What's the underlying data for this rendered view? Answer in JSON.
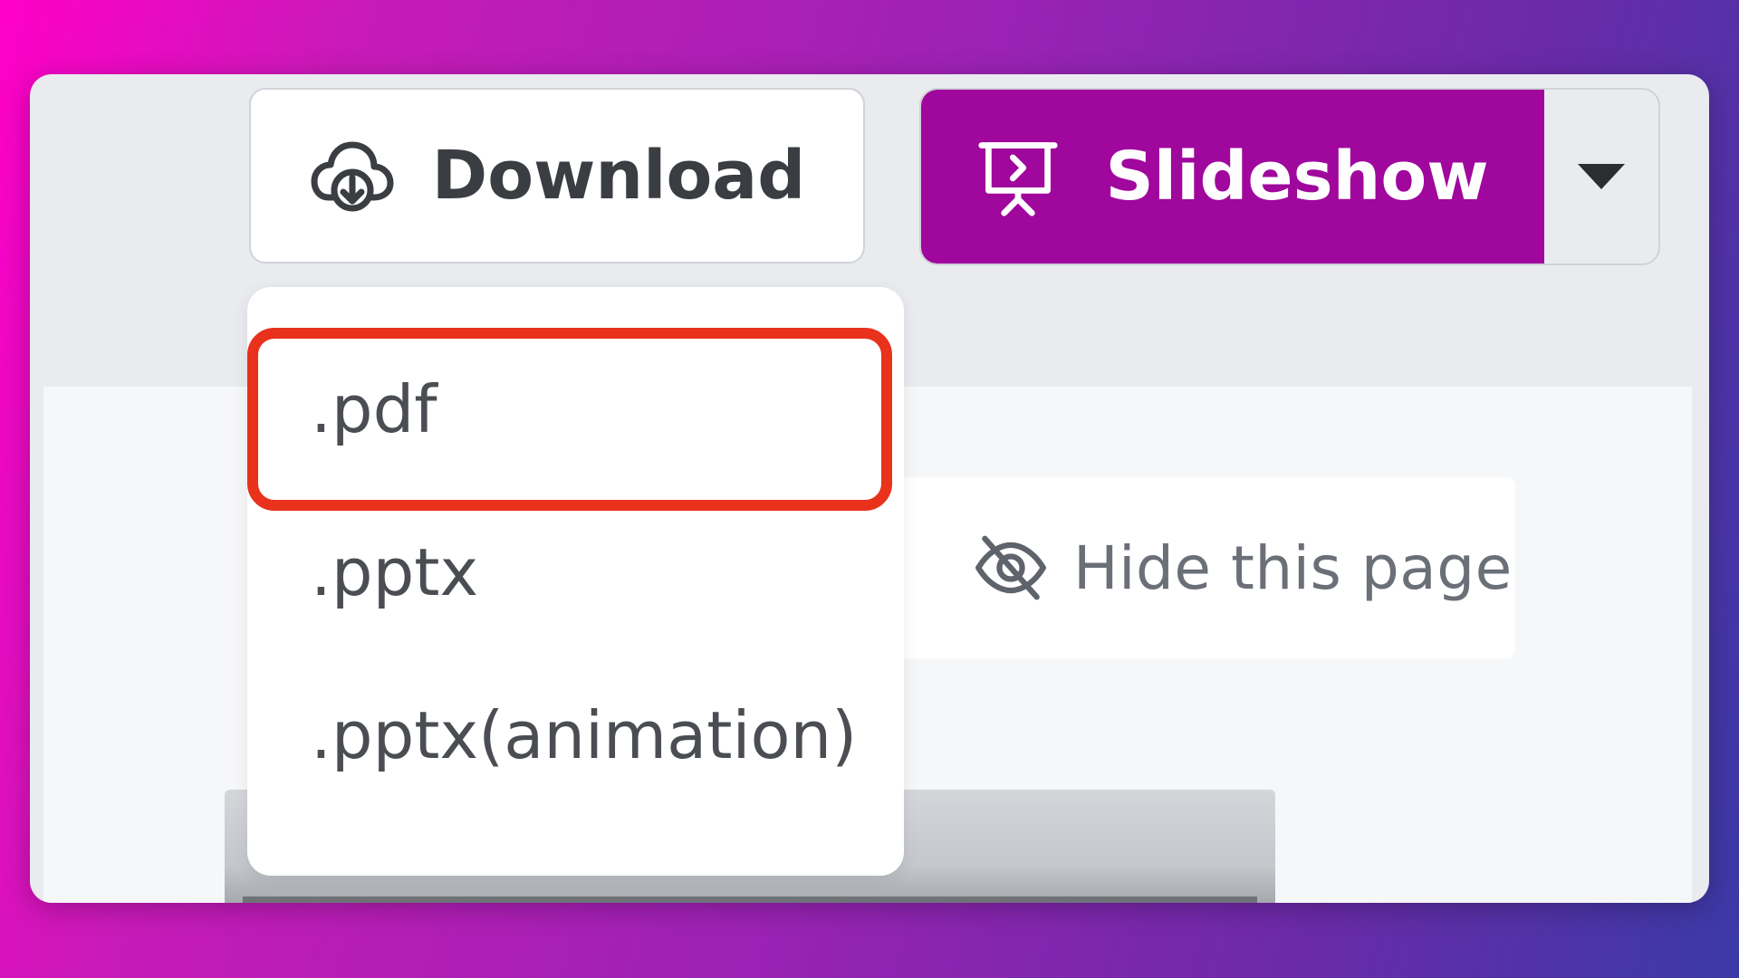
{
  "toolbar": {
    "download_label": "Download",
    "slideshow_label": "Slideshow"
  },
  "download_menu": {
    "items": [
      ".pdf",
      ".pptx",
      ".pptx(animation)"
    ],
    "highlighted_index": 0
  },
  "page_actions": {
    "hide_label": "Hide this page"
  },
  "colors": {
    "accent": "#a0079d",
    "highlight": "#e8321c"
  },
  "icons": {
    "download": "cloud-download-icon",
    "slideshow": "presentation-icon",
    "caret": "caret-down-icon",
    "hide": "eye-off-icon"
  }
}
